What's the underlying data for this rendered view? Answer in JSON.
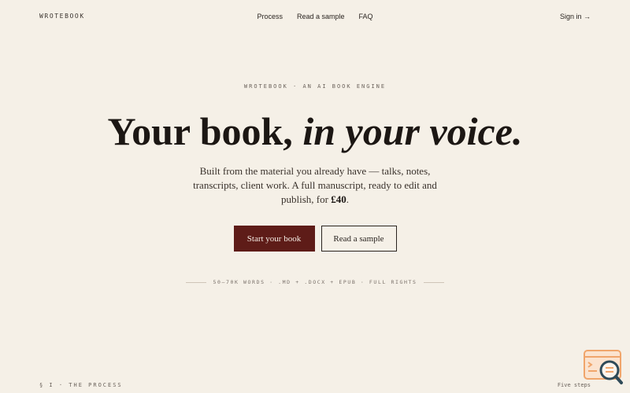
{
  "nav": {
    "brand": "WROTEBOOK",
    "links": [
      "Process",
      "Read a sample",
      "FAQ"
    ],
    "signin": "Sign in →"
  },
  "hero": {
    "eyebrow": "WROTEBOOK · AN AI BOOK ENGINE",
    "headline_plain": "Your book, ",
    "headline_italic": "in your voice.",
    "lede_before": "Built from the material you already have — talks, notes, transcripts, client work. A full manuscript, ready to edit and publish, for ",
    "lede_price": "£40",
    "lede_after": ".",
    "cta_primary": "Start your book",
    "cta_secondary": "Read a sample",
    "specs": "50–70K WORDS · .MD + .DOCX + EPUB · FULL RIGHTS"
  },
  "section": {
    "label": "§ I · THE PROCESS",
    "right": "Five steps"
  },
  "colors": {
    "background": "#f5f0e7",
    "accent": "#5e1c18",
    "text": "#1c1714"
  },
  "icons": {
    "widget": "search-chat-widget-icon"
  }
}
